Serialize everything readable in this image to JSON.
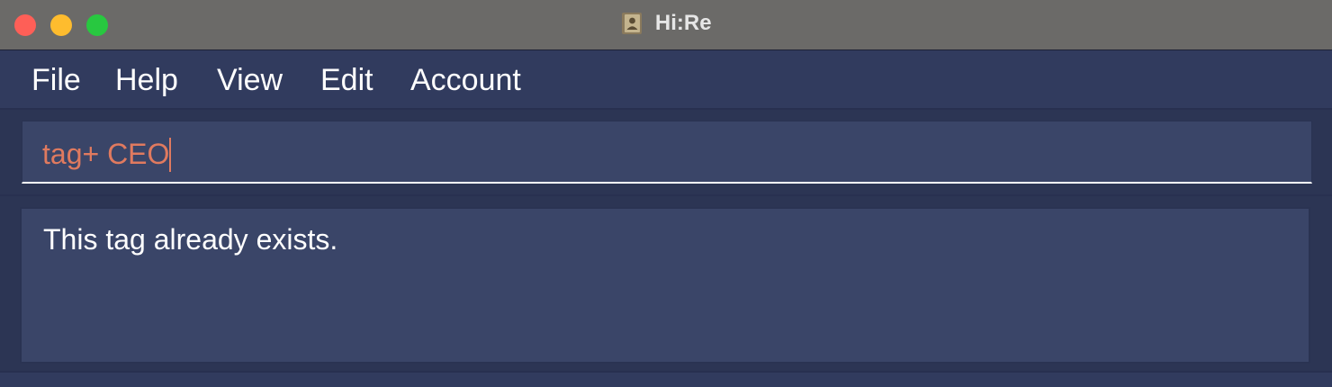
{
  "window": {
    "title": "Hi:Re",
    "icon": "contact-book-icon"
  },
  "menu": {
    "items": [
      {
        "label": "File"
      },
      {
        "label": "Help"
      },
      {
        "label": "View"
      },
      {
        "label": "Edit"
      },
      {
        "label": "Account"
      }
    ]
  },
  "command": {
    "value": "tag+ CEO",
    "color": "#e07a5f"
  },
  "result": {
    "message": "This tag already exists."
  },
  "colors": {
    "background": "#313b5e",
    "panel": "#3a4568",
    "titlebar": "#6b6a68",
    "close": "#fe5f57",
    "minimize": "#febc2e",
    "maximize": "#28c840"
  }
}
